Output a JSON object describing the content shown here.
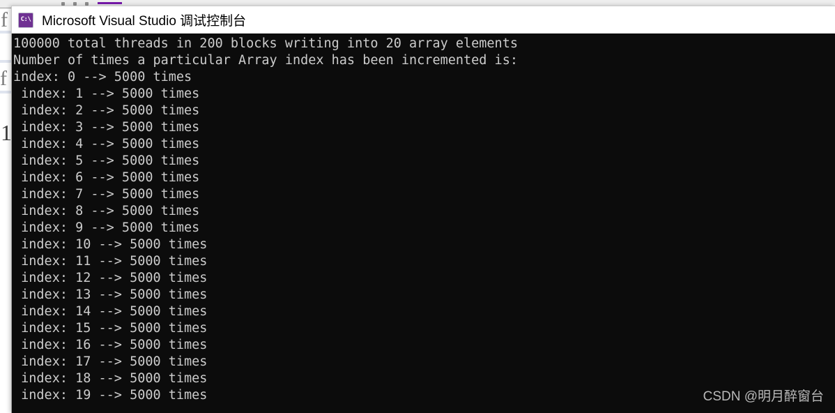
{
  "ide": {
    "toolbar": {
      "dot_icon": "toolbar-dot-icon",
      "accent_color": "#7719AA"
    },
    "editor_glyphs": {
      "glyph_f_upper": "f",
      "glyph_f_lower": "f",
      "glyph_one": "1"
    }
  },
  "console": {
    "icon_name": "command-prompt-icon",
    "icon_label": "C:\\",
    "icon_color": "#6F3192",
    "title": "Microsoft Visual Studio 调试控制台",
    "background_color": "#0C0C0C",
    "text_color": "#CCCCCC",
    "output_lines": [
      "100000 total threads in 200 blocks writing into 20 array elements",
      "Number of times a particular Array index has been incremented is:",
      "index: 0 --> 5000 times",
      " index: 1 --> 5000 times",
      " index: 2 --> 5000 times",
      " index: 3 --> 5000 times",
      " index: 4 --> 5000 times",
      " index: 5 --> 5000 times",
      " index: 6 --> 5000 times",
      " index: 7 --> 5000 times",
      " index: 8 --> 5000 times",
      " index: 9 --> 5000 times",
      " index: 10 --> 5000 times",
      " index: 11 --> 5000 times",
      " index: 12 --> 5000 times",
      " index: 13 --> 5000 times",
      " index: 14 --> 5000 times",
      " index: 15 --> 5000 times",
      " index: 16 --> 5000 times",
      " index: 17 --> 5000 times",
      " index: 18 --> 5000 times",
      " index: 19 --> 5000 times"
    ]
  },
  "watermark": {
    "text": "CSDN @明月醉窗台"
  }
}
